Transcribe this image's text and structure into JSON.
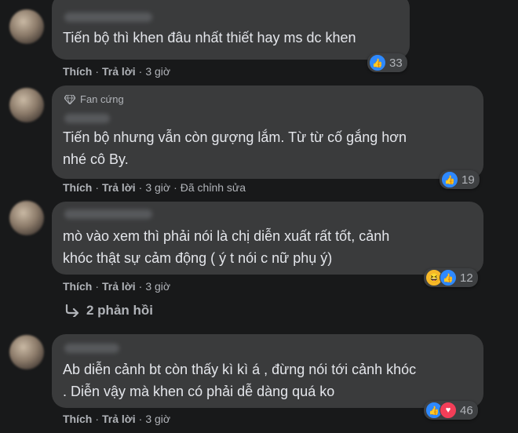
{
  "comments": [
    {
      "text": "Tiến bộ thì khen đâu nhất thiết hay ms dc khen",
      "reaction_count": "33",
      "actions": {
        "like": "Thích",
        "reply": "Trả lời",
        "time": "3 giờ",
        "edited": ""
      }
    },
    {
      "badge": "Fan cứng",
      "text": "Tiến bộ nhưng vẫn còn gượng lắm. Từ từ cố gắng hơn\nnhé cô By.",
      "reaction_count": "19",
      "actions": {
        "like": "Thích",
        "reply": "Trả lời",
        "time": "3 giờ",
        "edited": "Đã chỉnh sửa"
      }
    },
    {
      "text": "mò vào xem thì phải nói là chị diễn xuất rất tốt, cảnh\nkhóc thật sự cảm động ( ý t nói c nữ phụ ý)",
      "reaction_count": "12",
      "actions": {
        "like": "Thích",
        "reply": "Trả lời",
        "time": "3 giờ",
        "edited": ""
      }
    },
    {
      "text": "Ab diễn cảnh bt còn thấy kì kì á , đừng nói tới cảnh khóc\n. Diễn vậy mà khen có phải dễ dàng quá ko",
      "reaction_count": "46",
      "actions": {
        "like": "Thích",
        "reply": "Trả lời",
        "time": "3 giờ",
        "edited": ""
      }
    }
  ],
  "replies_link": "2 phản hồi",
  "colors": {
    "background": "#18191a",
    "bubble": "#3a3b3c",
    "text": "#e4e6eb",
    "muted": "#b0b3b8",
    "like": "#2e89ff",
    "love": "#f33e58",
    "haha": "#f7b928"
  }
}
